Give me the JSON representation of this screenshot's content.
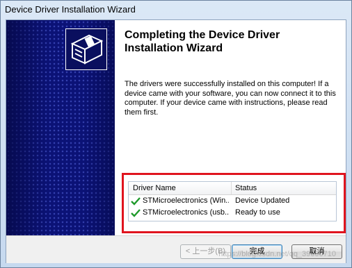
{
  "window": {
    "title": "Device Driver Installation Wizard"
  },
  "wizard": {
    "heading": "Completing the Device Driver Installation Wizard",
    "description": "The drivers were successfully installed on this computer! If a device came with your software, you can now connect it to this computer. If your device came with instructions, please read them first."
  },
  "driver_list": {
    "columns": [
      "Driver Name",
      "Status"
    ],
    "rows": [
      {
        "name": "STMicroelectronics (Win...",
        "status": "Device Updated",
        "icon": "checkmark-icon"
      },
      {
        "name": "STMicroelectronics (usb...",
        "status": "Ready to use",
        "icon": "checkmark-icon"
      }
    ]
  },
  "buttons": {
    "back": "< 上一步(B)",
    "finish": "完成",
    "cancel": "取消"
  },
  "watermark": "https://blog.csdn.net/qq_39600710",
  "colors": {
    "banner": "#0b1276",
    "highlight": "#e0141e",
    "check": "#1f9a2b"
  }
}
